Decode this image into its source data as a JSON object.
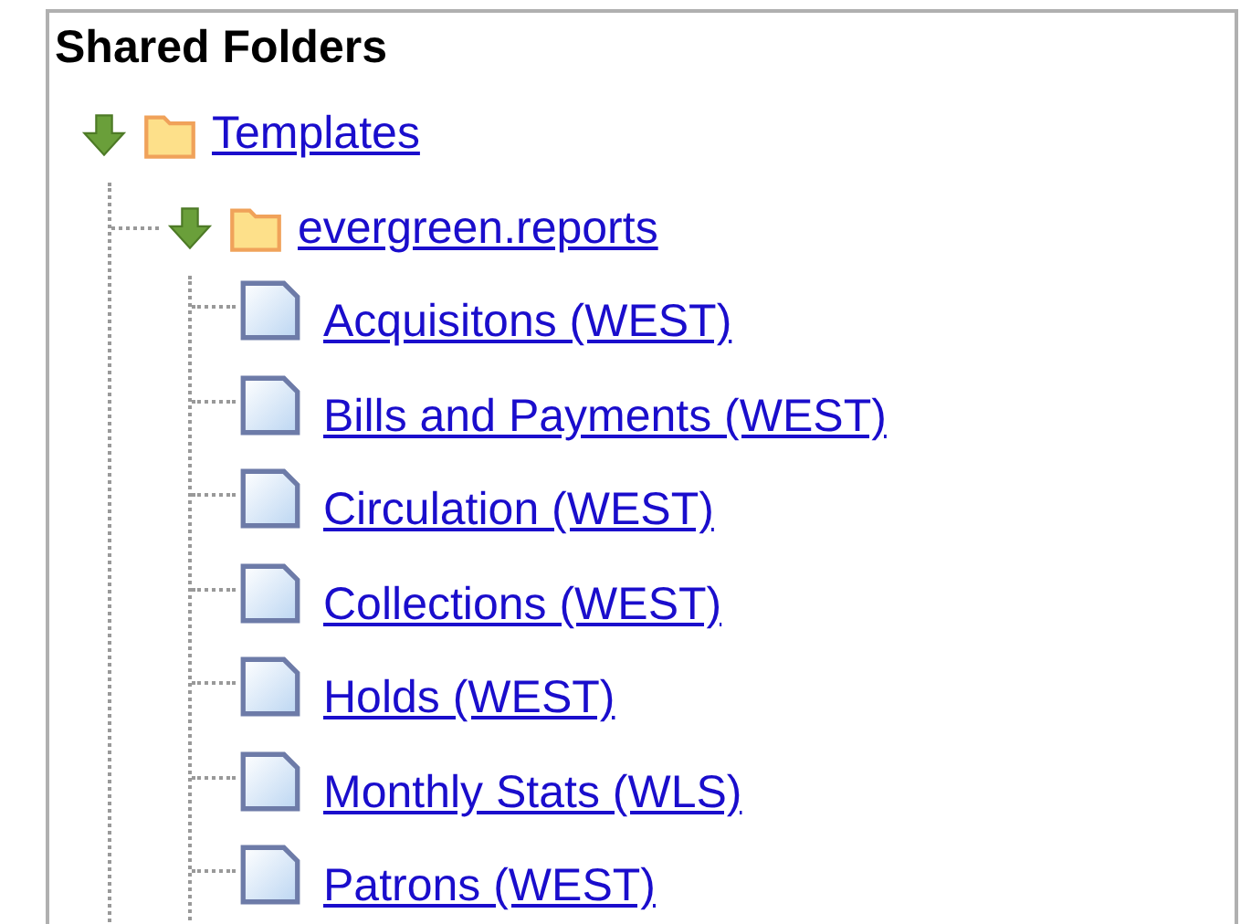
{
  "panel": {
    "title": "Shared Folders"
  },
  "tree": [
    {
      "kind": "folder",
      "label": "Templates",
      "expanded": true,
      "children": [
        {
          "kind": "folder",
          "label": "evergreen.reports",
          "expanded": true,
          "children": [
            {
              "kind": "report",
              "label": "Acquisitons (WEST)"
            },
            {
              "kind": "report",
              "label": "Bills and Payments (WEST)"
            },
            {
              "kind": "report",
              "label": "Circulation (WEST)"
            },
            {
              "kind": "report",
              "label": "Collections (WEST)"
            },
            {
              "kind": "report",
              "label": "Holds (WEST)"
            },
            {
              "kind": "report",
              "label": "Monthly Stats (WLS)"
            },
            {
              "kind": "report",
              "label": "Patrons (WEST)"
            }
          ]
        }
      ]
    }
  ]
}
